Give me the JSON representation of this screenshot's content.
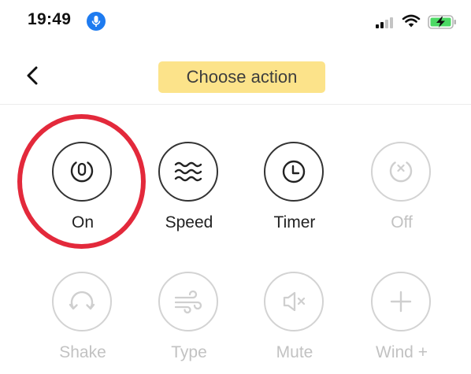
{
  "status_bar": {
    "time": "19:49",
    "icons": [
      "microphone-icon",
      "cellular-signal-icon",
      "wifi-icon",
      "battery-charging-icon"
    ]
  },
  "nav": {
    "back_icon": "chevron-left-icon",
    "title": "Choose action"
  },
  "actions": [
    {
      "label": "On",
      "icon": "power-icon",
      "enabled": true,
      "highlighted": true
    },
    {
      "label": "Speed",
      "icon": "wind-waves-icon",
      "enabled": true
    },
    {
      "label": "Timer",
      "icon": "clock-icon",
      "enabled": true
    },
    {
      "label": "Off",
      "icon": "power-off-icon",
      "enabled": false
    },
    {
      "label": "Shake",
      "icon": "oscillate-icon",
      "enabled": false
    },
    {
      "label": "Type",
      "icon": "wind-type-icon",
      "enabled": false
    },
    {
      "label": "Mute",
      "icon": "mute-icon",
      "enabled": false
    },
    {
      "label": "Wind +",
      "icon": "plus-icon",
      "enabled": false
    }
  ],
  "colors": {
    "title_chip": "#fce38a",
    "highlight_ring": "#e3293b",
    "mic_badge": "#1e7bf0",
    "battery_fill": "#4cd964",
    "active_stroke": "#333333",
    "disabled_stroke": "#d3d3d3",
    "disabled_text": "#c2c2c2"
  }
}
